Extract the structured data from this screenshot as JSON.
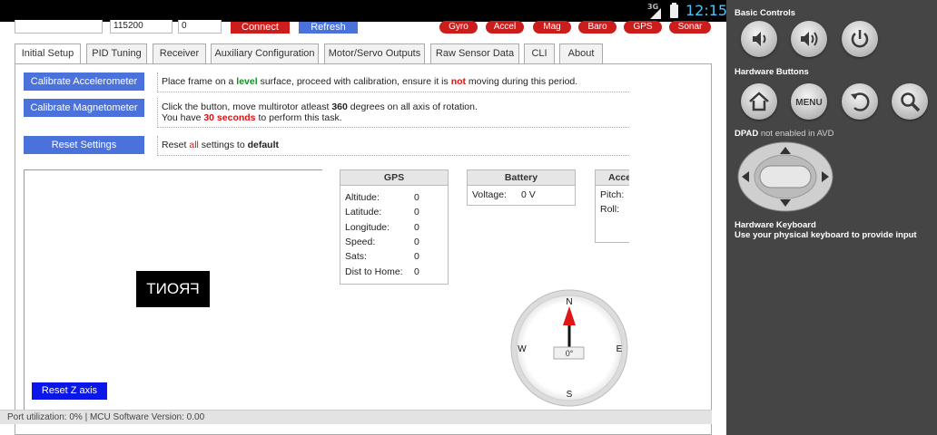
{
  "status_bar": {
    "network": "3G",
    "time": "12:15"
  },
  "connection": {
    "baud": "115200",
    "port": "0",
    "connect_label": "Connect",
    "refresh_label": "Refresh"
  },
  "sensors": [
    "Gyro",
    "Accel",
    "Mag",
    "Baro",
    "GPS",
    "Sonar"
  ],
  "tabs": [
    "Initial Setup",
    "PID Tuning",
    "Receiver",
    "Auxiliary Configuration",
    "Motor/Servo Outputs",
    "Raw Sensor Data",
    "CLI",
    "About"
  ],
  "actions": {
    "calib_acc": {
      "label": "Calibrate Accelerometer",
      "t1": "Place frame on a ",
      "t2": "level",
      "t3": " surface, proceed with calibration, ensure it is ",
      "t4": "not",
      "t5": " moving during this period."
    },
    "calib_mag": {
      "label": "Calibrate Magnetometer",
      "l1a": "Click the button, move multirotor atleast ",
      "l1b": "360",
      "l1c": " degrees on all axis of rotation.",
      "l2a": "You have ",
      "l2b": "30 seconds",
      "l2c": " to perform this task."
    },
    "reset": {
      "label": "Reset Settings",
      "t1": "Reset ",
      "t2": "all",
      "t3": " settings to ",
      "t4": "default"
    }
  },
  "model": {
    "front_label": "FRONT",
    "reset_z_label": "Reset Z axis"
  },
  "gps": {
    "title": "GPS",
    "rows": [
      {
        "label": "Altitude:",
        "value": "0"
      },
      {
        "label": "Latitude:",
        "value": "0"
      },
      {
        "label": "Longitude:",
        "value": "0"
      },
      {
        "label": "Speed:",
        "value": "0"
      },
      {
        "label": "Sats:",
        "value": "0"
      },
      {
        "label": "Dist to Home:",
        "value": "0"
      }
    ]
  },
  "battery": {
    "title": "Battery",
    "voltage_label": "Voltage:",
    "voltage_value": "0 V"
  },
  "accel": {
    "title": "Acce",
    "pitch_label": "Pitch:",
    "roll_label": "Roll:"
  },
  "compass": {
    "n": "N",
    "s": "S",
    "e": "E",
    "w": "W",
    "heading": "0°"
  },
  "status_line": "Port utilization: 0% | MCU Software Version: 0.00",
  "side": {
    "basic_controls": "Basic Controls",
    "hardware_buttons": "Hardware Buttons",
    "menu_label": "MENU",
    "dpad_a": "DPAD",
    "dpad_b": " not enabled in AVD",
    "keyboard_title": "Hardware Keyboard",
    "keyboard_desc": "Use your physical keyboard to provide input"
  },
  "colors": {
    "accent_red": "#cc1d1d",
    "accent_blue": "#4b72db",
    "reset_z_blue": "#0b17e8",
    "clock": "#4fc3f7"
  }
}
